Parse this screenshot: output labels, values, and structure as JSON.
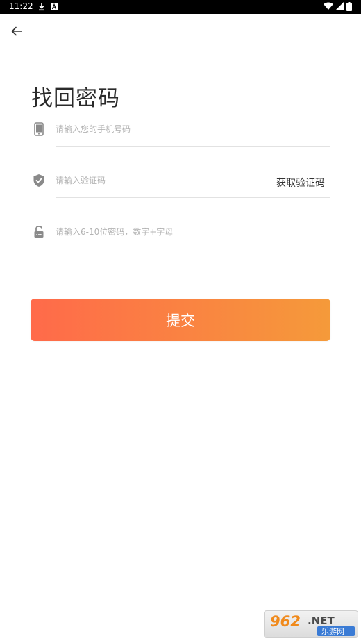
{
  "status_bar": {
    "time": "11:22",
    "left_icons": [
      "download-icon",
      "a-box-icon"
    ],
    "right_icons": [
      "wifi-icon",
      "signal-icon",
      "battery-icon"
    ]
  },
  "nav": {
    "back_icon": "arrow-left-icon"
  },
  "page": {
    "title": "找回密码"
  },
  "form": {
    "phone": {
      "icon": "phone-icon",
      "placeholder": "请输入您的手机号码",
      "value": ""
    },
    "code": {
      "icon": "shield-check-icon",
      "placeholder": "请输入验证码",
      "value": "",
      "get_code_label": "获取验证码"
    },
    "password": {
      "icon": "unlock-icon",
      "placeholder": "请输入6-10位密码，数字+字母",
      "value": ""
    },
    "submit_label": "提交"
  },
  "colors": {
    "accent_start": "#ff6a4a",
    "accent_end": "#f59a3a",
    "title_text": "#2a2a2a",
    "placeholder": "#b3b3b3",
    "icon_gray": "#8a8a8a"
  },
  "watermark": {
    "brand": "962.NET",
    "caption": "乐游网"
  }
}
